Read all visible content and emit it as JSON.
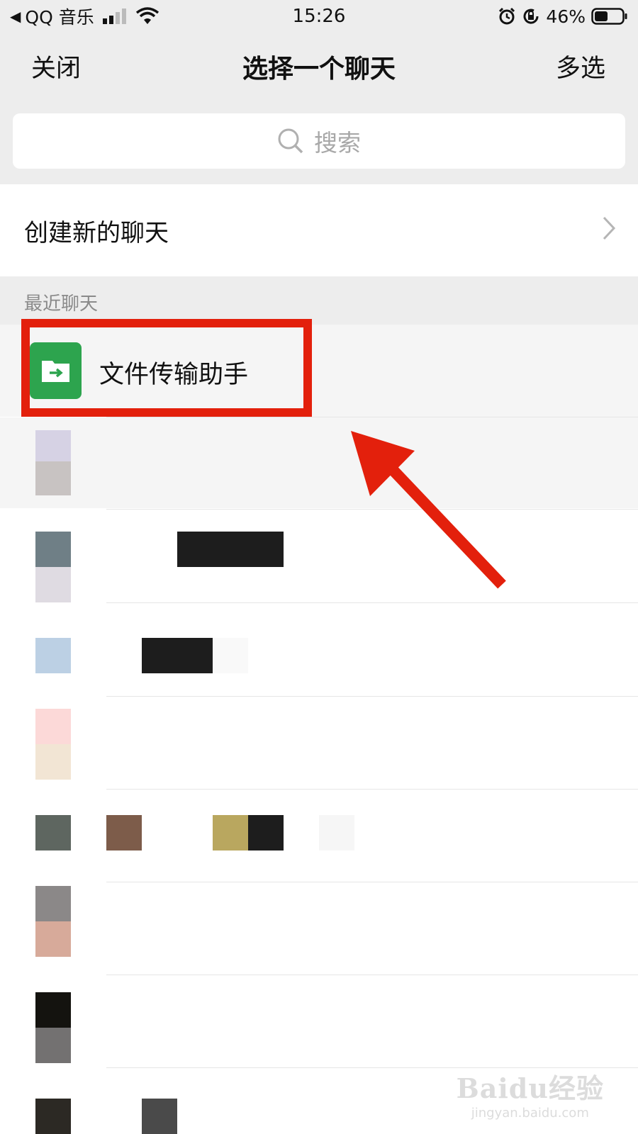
{
  "status_bar": {
    "back_app": "QQ 音乐",
    "time": "15:26",
    "battery": "46%"
  },
  "nav": {
    "close_label": "关闭",
    "title": "选择一个聊天",
    "multi_select_label": "多选"
  },
  "search": {
    "placeholder": "搜索"
  },
  "new_chat": {
    "label": "创建新的聊天"
  },
  "recent_section": {
    "label": "最近聊天"
  },
  "chats": [
    {
      "name": "文件传输助手",
      "icon": "folder-arrow-icon",
      "avatar_color": "#2da44e"
    }
  ],
  "annotation": {
    "highlight_color": "#e3200c"
  },
  "watermark": {
    "brand": "Baidu经验",
    "site": "jingyan.baidu.com"
  }
}
